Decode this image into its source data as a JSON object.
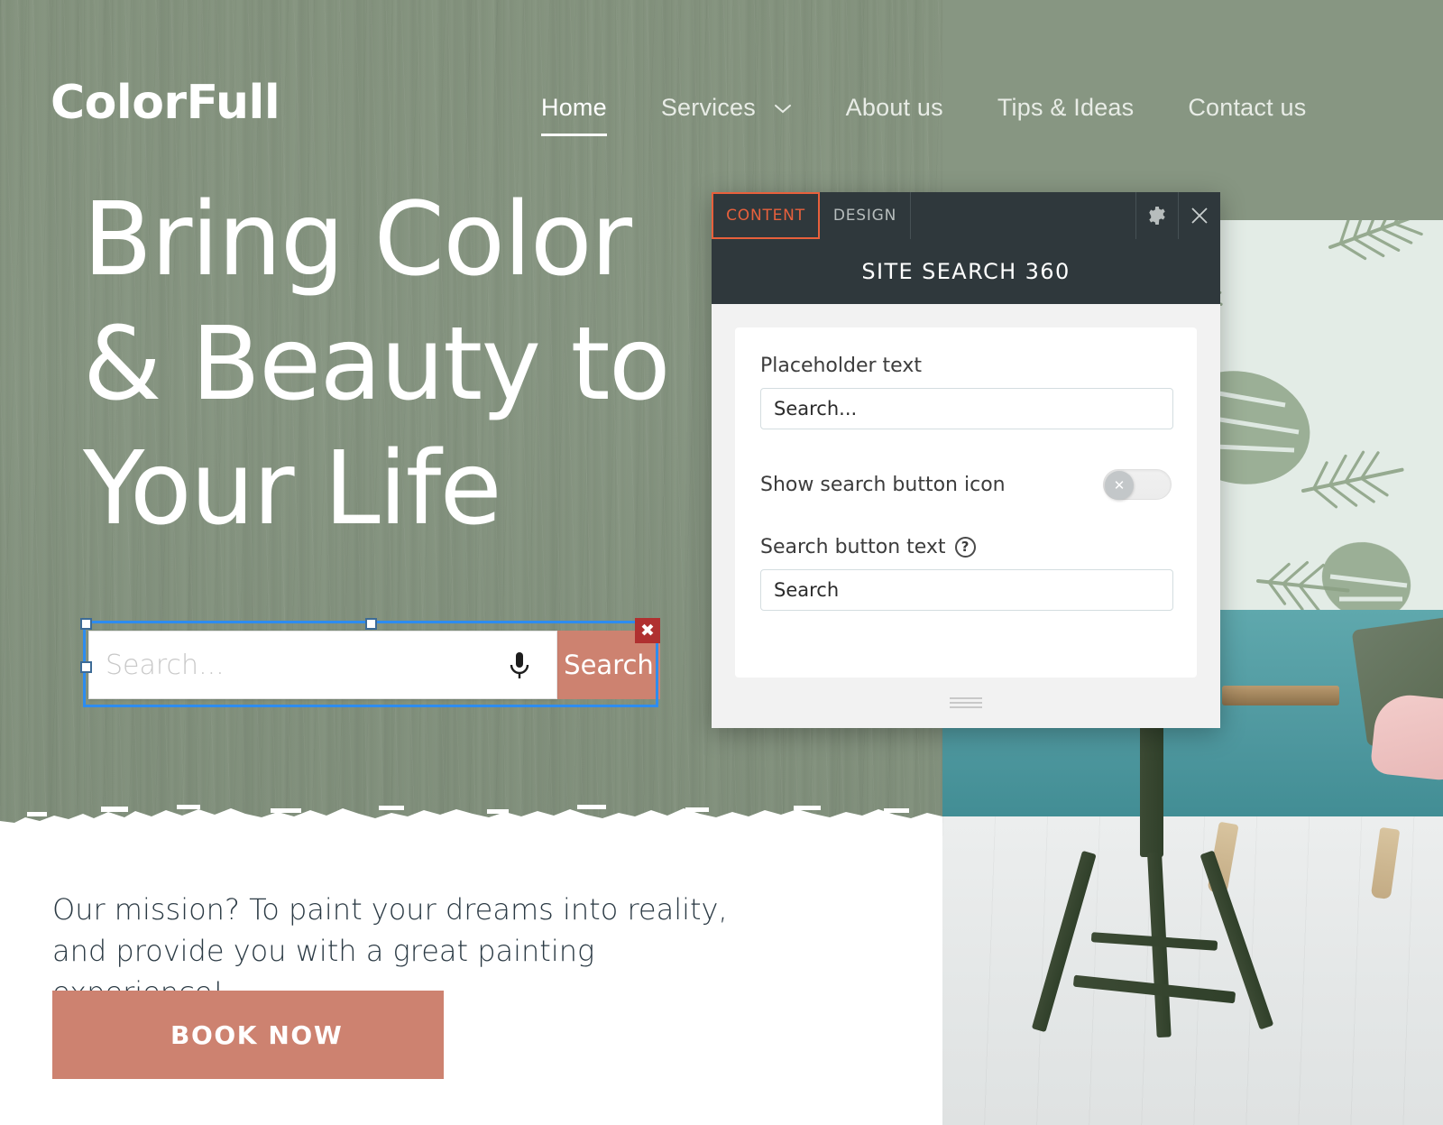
{
  "site": {
    "brand": "ColorFull",
    "nav": [
      {
        "label": "Home",
        "active": true,
        "has_caret": false
      },
      {
        "label": "Services",
        "active": false,
        "has_caret": true
      },
      {
        "label": "About us",
        "active": false,
        "has_caret": false
      },
      {
        "label": "Tips & Ideas",
        "active": false,
        "has_caret": false
      },
      {
        "label": "Contact us",
        "active": false,
        "has_caret": false
      }
    ],
    "headline_line1": "Bring Color",
    "headline_line2": "& Beauty to",
    "headline_line3": "Your Life",
    "mission": "Our mission? To paint your dreams into reality, and provide you with a great painting experience!",
    "book_button": "BOOK NOW"
  },
  "search_widget": {
    "placeholder": "Search...",
    "button_label": "Search",
    "mic_icon": "microphone-icon",
    "delete_icon": "✖",
    "selected": true
  },
  "editor_panel": {
    "tabs": [
      {
        "id": "content",
        "label": "CONTENT",
        "active": true
      },
      {
        "id": "design",
        "label": "DESIGN",
        "active": false
      }
    ],
    "settings_icon": "gear-icon",
    "close_icon": "close-icon",
    "title": "SITE SEARCH 360",
    "fields": {
      "placeholder_label": "Placeholder text",
      "placeholder_value": "Search...",
      "toggle_label": "Show search button icon",
      "toggle_state": "off",
      "toggle_knob_glyph": "✕",
      "button_text_label": "Search button text",
      "button_text_help": "?",
      "button_text_value": "Search"
    },
    "resize_grip": "drag-handle"
  },
  "colors": {
    "wall_green": "#879682",
    "accent_terracotta": "#cd8270",
    "panel_dark": "#2f383c",
    "tab_orange": "#e8603c",
    "selection_blue": "#2d8cf0",
    "delete_red": "#b03030",
    "text_dark": "#2b3a44"
  }
}
